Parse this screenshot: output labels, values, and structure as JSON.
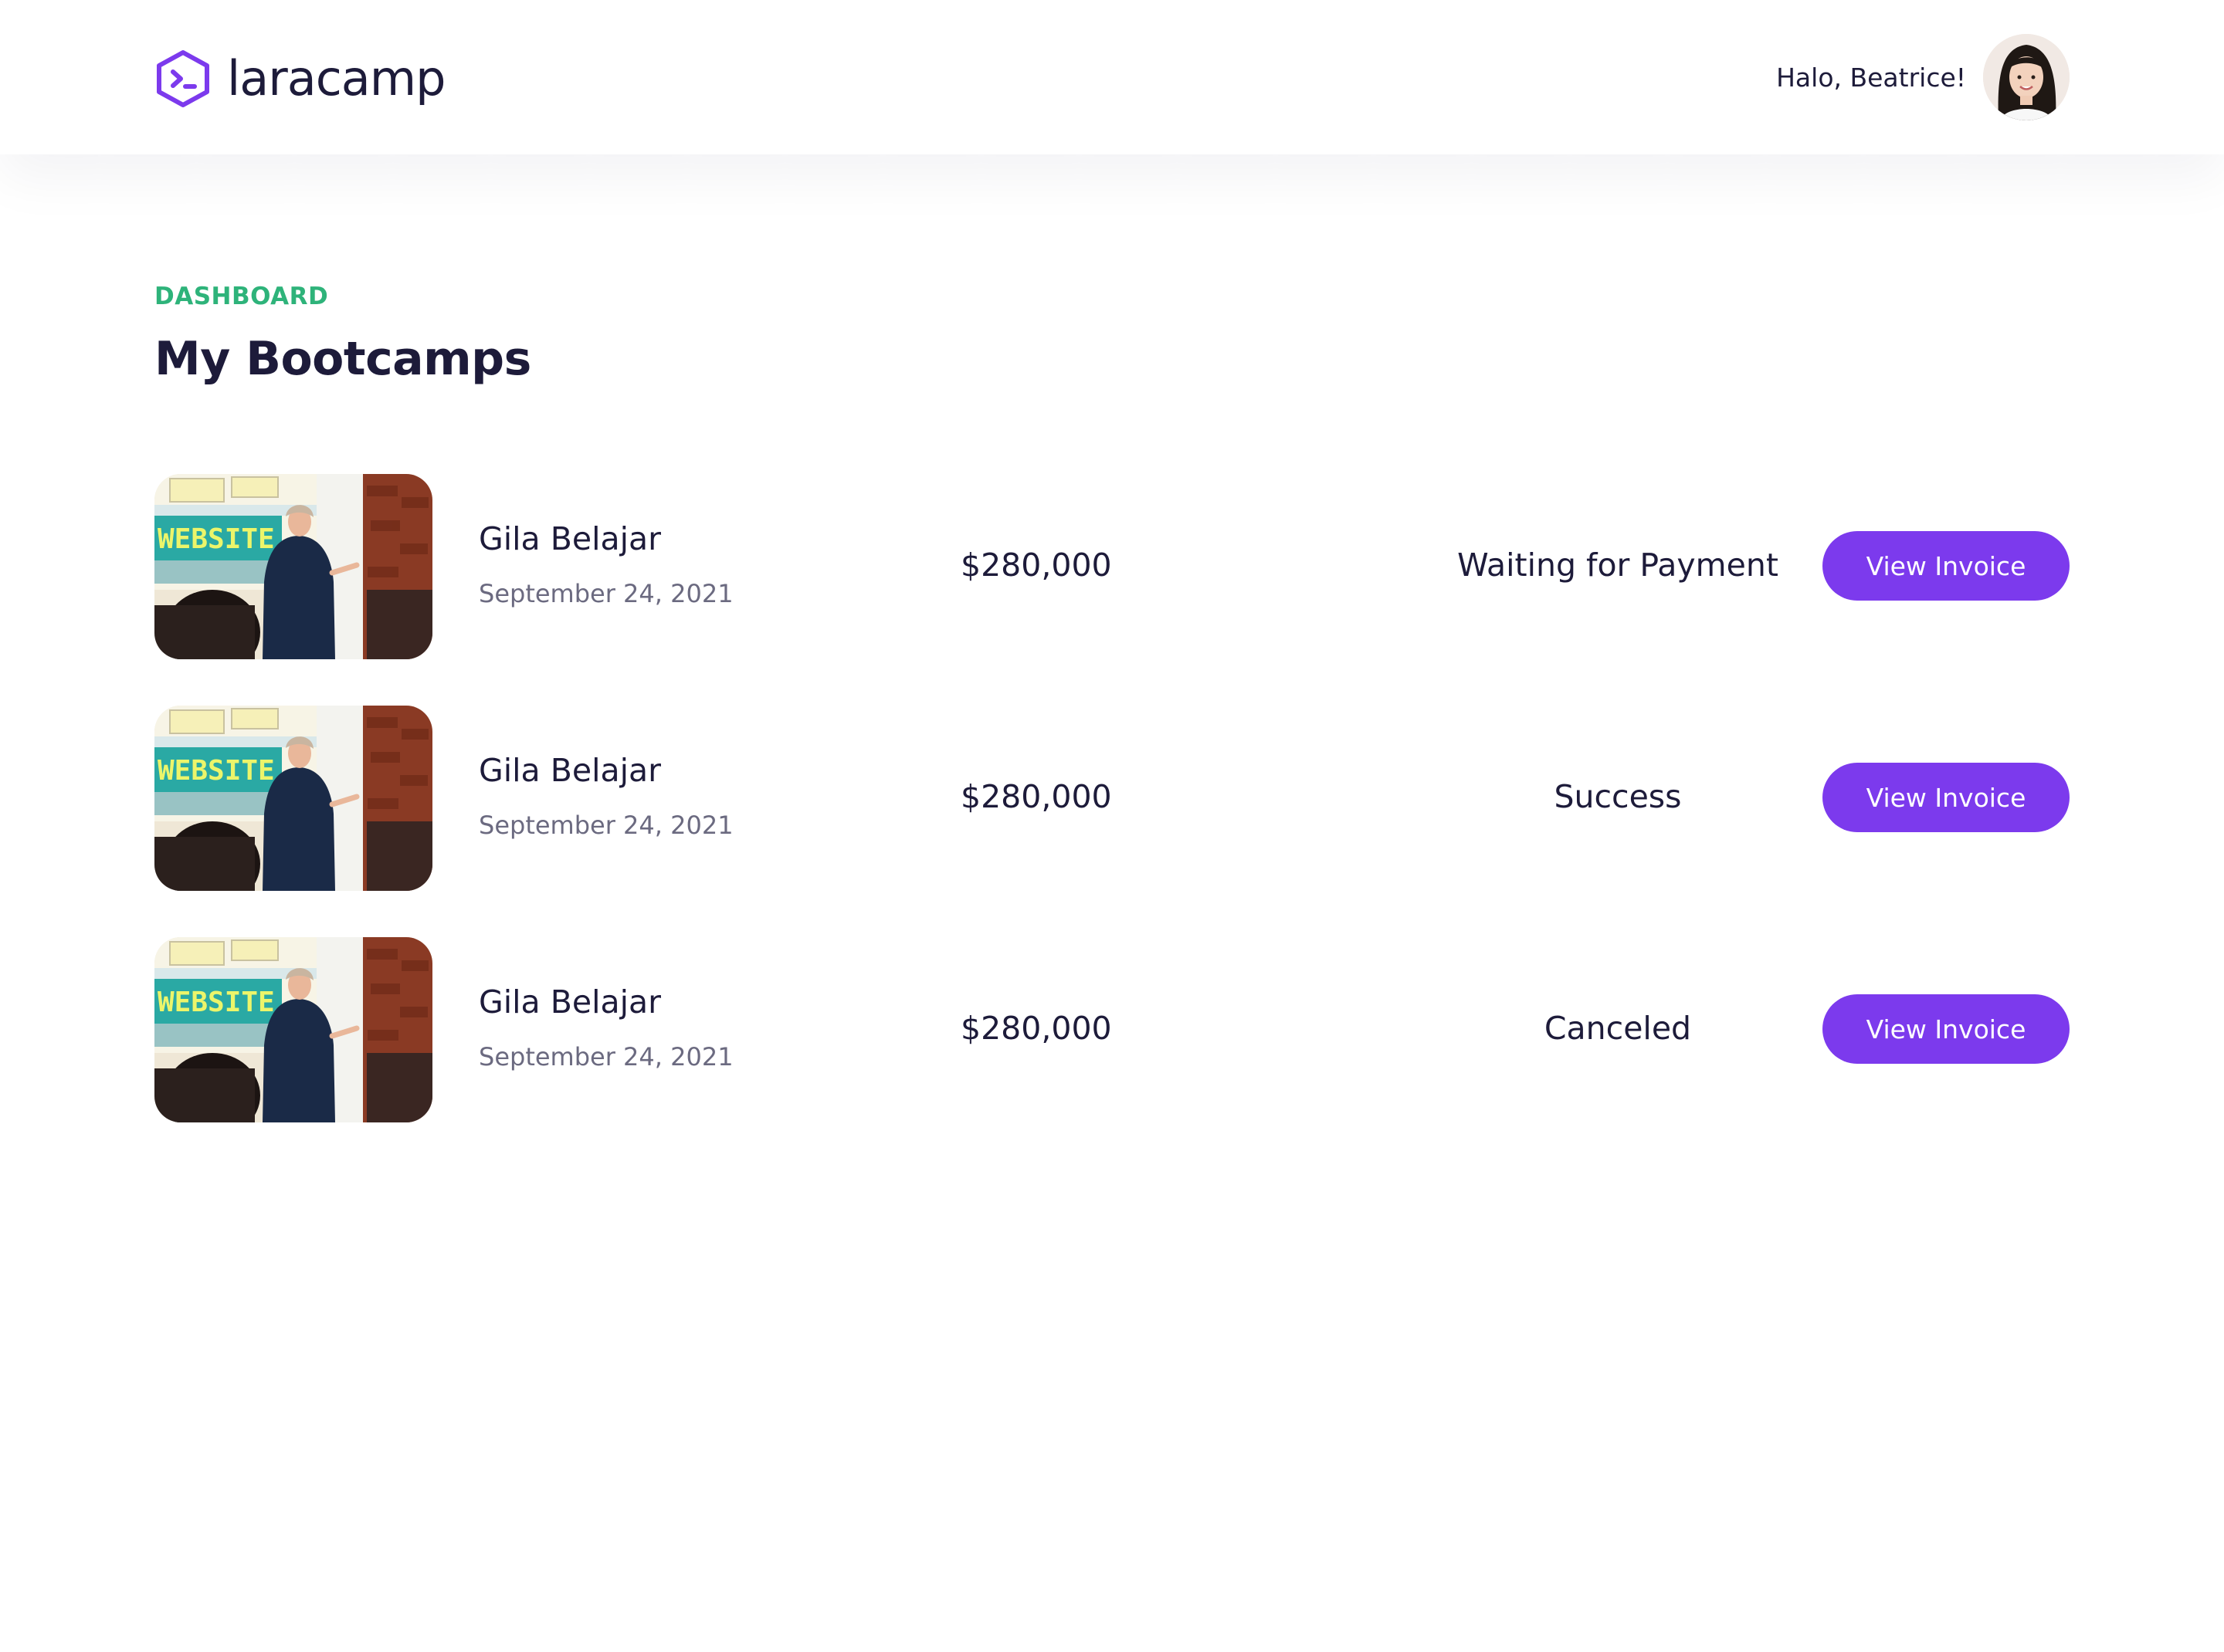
{
  "brand": {
    "name": "laracamp",
    "icon": "terminal-hexagon-icon",
    "color": "#7c3aed"
  },
  "header": {
    "greeting": "Halo, Beatrice!",
    "avatar": "user-avatar"
  },
  "dashboard": {
    "label": "DASHBOARD",
    "title": "My Bootcamps",
    "rows": [
      {
        "name": "Gila Belajar",
        "date": "September 24, 2021",
        "price": "$280,000",
        "status": "Waiting for Payment",
        "button": "View Invoice",
        "thumb_text": "WEBSITE"
      },
      {
        "name": "Gila Belajar",
        "date": "September 24, 2021",
        "price": "$280,000",
        "status": "Success",
        "button": "View Invoice",
        "thumb_text": "WEBSITE"
      },
      {
        "name": "Gila Belajar",
        "date": "September 24, 2021",
        "price": "$280,000",
        "status": "Canceled",
        "button": "View Invoice",
        "thumb_text": "WEBSITE"
      }
    ]
  },
  "colors": {
    "accent": "#7c3aed",
    "label_green": "#2eb37a",
    "text_dark": "#1d1b3a",
    "text_muted": "#6b6a80"
  }
}
